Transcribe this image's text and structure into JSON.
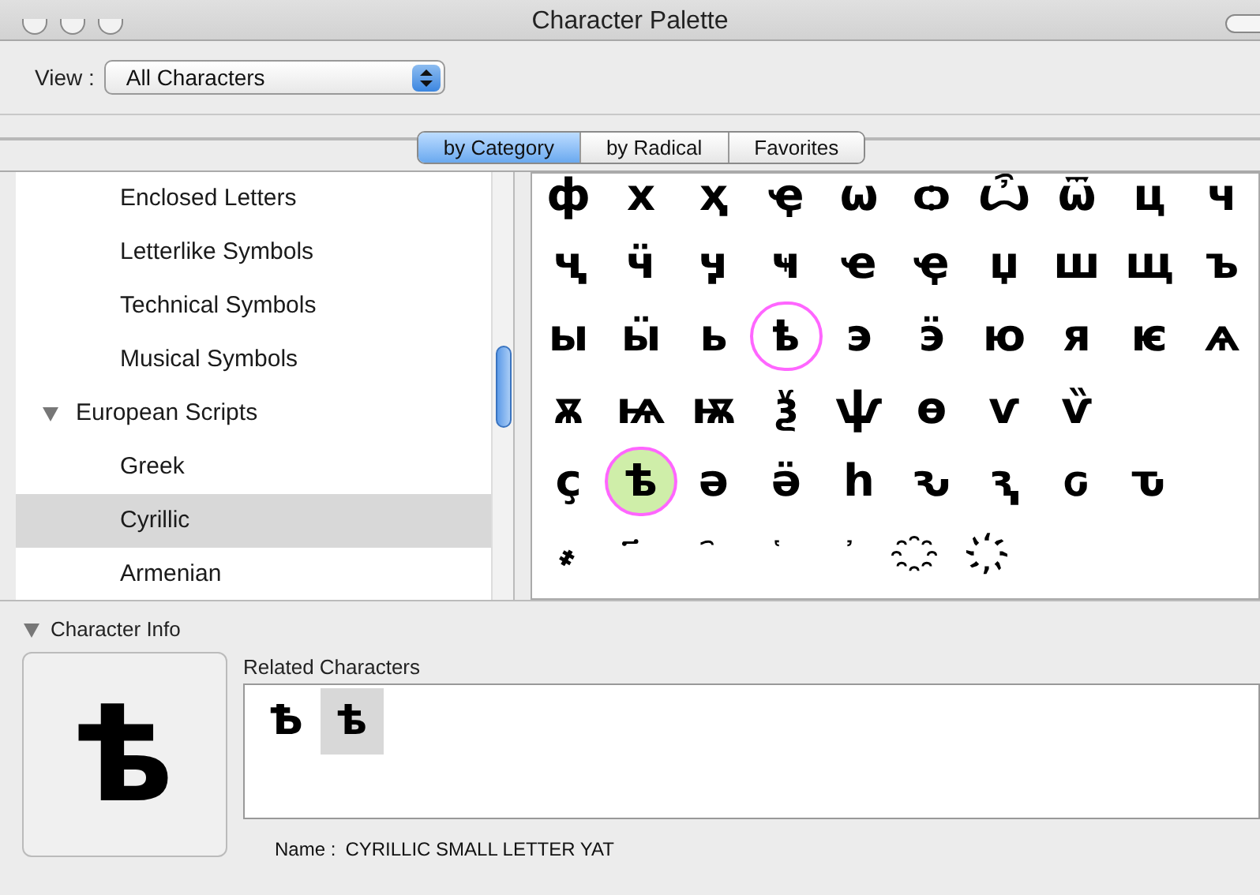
{
  "window": {
    "title": "Character Palette"
  },
  "view": {
    "label": "View :",
    "value": "All Characters"
  },
  "tabs": [
    {
      "label": "by Category",
      "selected": true
    },
    {
      "label": "by Radical",
      "selected": false
    },
    {
      "label": "Favorites",
      "selected": false
    }
  ],
  "sidebar": {
    "items": [
      {
        "label": "Enclosed Letters",
        "selected": false
      },
      {
        "label": "Letterlike Symbols",
        "selected": false
      },
      {
        "label": "Technical Symbols",
        "selected": false
      },
      {
        "label": "Musical Symbols",
        "selected": false
      },
      {
        "label": "European Scripts",
        "selected": false,
        "expanded": true,
        "children": [
          {
            "label": "Greek",
            "selected": false
          },
          {
            "label": "Cyrillic",
            "selected": true
          },
          {
            "label": "Armenian",
            "selected": false
          }
        ]
      }
    ]
  },
  "grid": {
    "rows": [
      [
        {
          "char": "ф",
          "selected": false,
          "circled": false
        },
        {
          "char": "х",
          "selected": false,
          "circled": false
        },
        {
          "char": "ҳ",
          "selected": false,
          "circled": false
        },
        {
          "char": "ҿ",
          "selected": false,
          "circled": false
        },
        {
          "char": "ѡ",
          "selected": false,
          "circled": false
        },
        {
          "char": "ѻ",
          "selected": false,
          "circled": false
        },
        {
          "char": "ѽ",
          "selected": false,
          "circled": false
        },
        {
          "char": "ѿ",
          "selected": false,
          "circled": false
        },
        {
          "char": "ц",
          "selected": false,
          "circled": false
        },
        {
          "char": "ч",
          "selected": false,
          "circled": false
        }
      ],
      [
        {
          "char": "ҷ",
          "selected": false,
          "circled": false
        },
        {
          "char": "ӵ",
          "selected": false,
          "circled": false
        },
        {
          "char": "ӌ",
          "selected": false,
          "circled": false
        },
        {
          "char": "ҹ",
          "selected": false,
          "circled": false
        },
        {
          "char": "ҽ",
          "selected": false,
          "circled": false
        },
        {
          "char": "ҿ",
          "selected": false,
          "circled": false
        },
        {
          "char": "џ",
          "selected": false,
          "circled": false
        },
        {
          "char": "ш",
          "selected": false,
          "circled": false
        },
        {
          "char": "щ",
          "selected": false,
          "circled": false
        },
        {
          "char": "ъ",
          "selected": false,
          "circled": false
        }
      ],
      [
        {
          "char": "ы",
          "selected": false,
          "circled": false
        },
        {
          "char": "ӹ",
          "selected": false,
          "circled": false
        },
        {
          "char": "ь",
          "selected": false,
          "circled": false
        },
        {
          "char": "ҍ",
          "selected": false,
          "circled": true
        },
        {
          "char": "э",
          "selected": false,
          "circled": false
        },
        {
          "char": "ӭ",
          "selected": false,
          "circled": false
        },
        {
          "char": "ю",
          "selected": false,
          "circled": false
        },
        {
          "char": "я",
          "selected": false,
          "circled": false
        },
        {
          "char": "ѥ",
          "selected": false,
          "circled": false
        },
        {
          "char": "ѧ",
          "selected": false,
          "circled": false
        }
      ],
      [
        {
          "char": "ѫ",
          "selected": false,
          "circled": false
        },
        {
          "char": "ѩ",
          "selected": false,
          "circled": false
        },
        {
          "char": "ѭ",
          "selected": false,
          "circled": false
        },
        {
          "char": "ѯ",
          "selected": false,
          "circled": false
        },
        {
          "char": "ѱ",
          "selected": false,
          "circled": false
        },
        {
          "char": "ѳ",
          "selected": false,
          "circled": false
        },
        {
          "char": "ѵ",
          "selected": false,
          "circled": false
        },
        {
          "char": "ѷ",
          "selected": false,
          "circled": false
        }
      ],
      [
        {
          "char": "ҫ",
          "selected": false,
          "circled": false
        },
        {
          "char": "ѣ",
          "selected": true,
          "circled": true
        },
        {
          "char": "ә",
          "selected": false,
          "circled": false
        },
        {
          "char": "ӛ",
          "selected": false,
          "circled": false
        },
        {
          "char": "һ",
          "selected": false,
          "circled": false
        },
        {
          "char": "ԅ",
          "selected": false,
          "circled": false
        },
        {
          "char": "ԇ",
          "selected": false,
          "circled": false
        },
        {
          "char": "ԍ",
          "selected": false,
          "circled": false
        },
        {
          "char": "ԏ",
          "selected": false,
          "circled": false
        }
      ],
      [
        {
          "char": "҂",
          "selected": false,
          "circled": false
        },
        {
          "char": "҃",
          "selected": false,
          "circled": false
        },
        {
          "char": "҄",
          "selected": false,
          "circled": false
        },
        {
          "char": "҅",
          "selected": false,
          "circled": false
        },
        {
          "char": "҆",
          "selected": false,
          "circled": false
        },
        {
          "char": "҈",
          "selected": false,
          "circled": false
        },
        {
          "char": "҉",
          "selected": false,
          "circled": false
        }
      ]
    ]
  },
  "info": {
    "title": "Character Info",
    "expanded": true,
    "preview": "ѣ",
    "related_label": "Related Characters",
    "related": [
      {
        "char": "Ѣ",
        "selected": false
      },
      {
        "char": "ѣ",
        "selected": true
      }
    ],
    "name_label": "Name :",
    "name": "CYRILLIC SMALL LETTER YAT"
  }
}
